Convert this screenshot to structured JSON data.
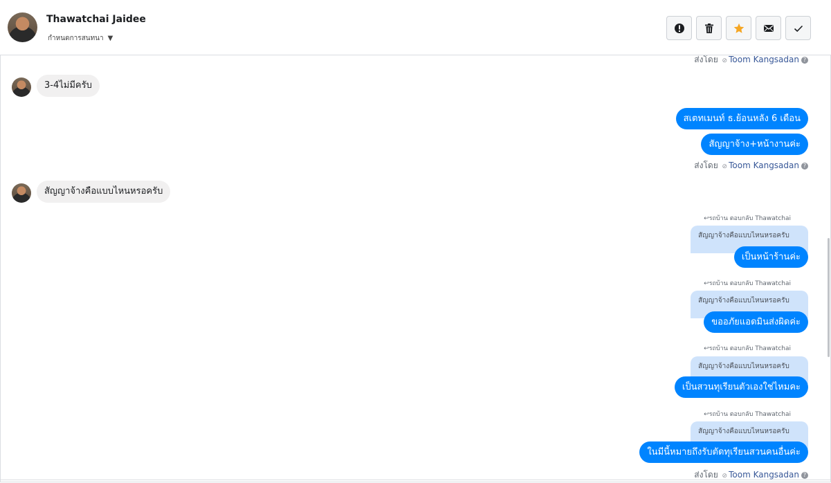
{
  "header": {
    "contact_name": "Thawatchai Jaidee",
    "subtitle": "กำหนดการสนทนา",
    "actions": [
      {
        "id": "alert",
        "icon": "alert-icon",
        "color": "#1c1e21"
      },
      {
        "id": "trash",
        "icon": "trash-icon",
        "color": "#1c1e21"
      },
      {
        "id": "star",
        "icon": "star-icon",
        "color": "#f5a623"
      },
      {
        "id": "mail",
        "icon": "mail-icon",
        "color": "#1c1e21"
      },
      {
        "id": "check",
        "icon": "check-icon",
        "color": "#1c1e21"
      }
    ]
  },
  "conversation": {
    "sent_by_prefix": "ส่งโดย",
    "agent_name": "Toom Kangsadan",
    "reply_label": "รถบ้าน ตอบกลับ Thawatchai",
    "quoted_text": "สัญญาจ้างคือแบบไหนหรอครับ",
    "messages": {
      "in_1": "3-4ไม่มีครับ",
      "out_1": "สเตทเมนท์ ธ.ย้อนหลัง 6 เดือน",
      "out_2": "สัญญาจ้าง+หน้างานค่ะ",
      "in_2": "สัญญาจ้างคือแบบไหนหรอครับ",
      "reply_1": "เป็นหน้าร้านค่ะ",
      "reply_2": "ขออภัยแอดมินส่งผิดค่ะ",
      "reply_3": "เป็นสวนทุเรียนตัวเองใช่ไหมคะ",
      "reply_4": "ในมีนี้หมายถึงรับตัดทุเรียนสวนคนอื่นค่ะ"
    }
  },
  "colors": {
    "outgoing": "#0084ff",
    "incoming": "#f1f0f0",
    "quote": "#cfe3fb",
    "accent_star": "#f5a623",
    "agent_link": "#385898"
  }
}
